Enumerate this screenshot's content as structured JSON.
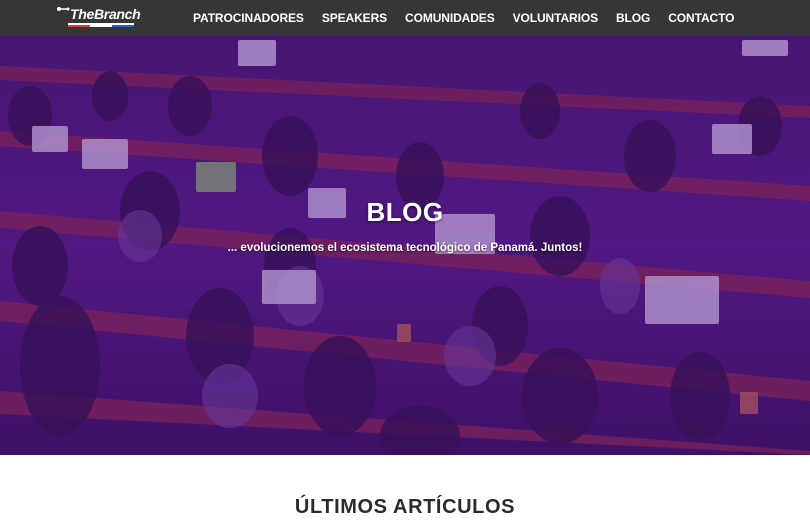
{
  "brand": {
    "logo_text": "TheBranch"
  },
  "nav": {
    "items": [
      {
        "label": "PATROCINADORES"
      },
      {
        "label": "SPEAKERS"
      },
      {
        "label": "COMUNIDADES"
      },
      {
        "label": "VOLUNTARIOS"
      },
      {
        "label": "BLOG"
      },
      {
        "label": "CONTACTO"
      }
    ]
  },
  "hero": {
    "title": "BLOG",
    "subtitle": "... evolucionemos el ecosistema tecnológico de Panamá. Juntos!"
  },
  "main": {
    "section_title": "ÚLTIMOS ARTÍCULOS"
  },
  "colors": {
    "navbar_bg": "#363636",
    "hero_tint": "#5f1496",
    "logo_accent": "#e23a3a",
    "logo_blue": "#2a5bd7"
  }
}
